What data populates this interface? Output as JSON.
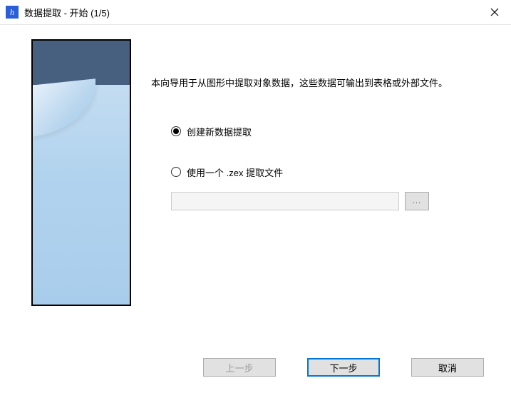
{
  "window": {
    "title": "数据提取 - 开始 (1/5)"
  },
  "intro": "本向导用于从图形中提取对象数据，这些数据可输出到表格或外部文件。",
  "options": {
    "create_new": "创建新数据提取",
    "use_file": "使用一个 .zex 提取文件",
    "file_value": "",
    "browse_label": "..."
  },
  "buttons": {
    "back": "上一步",
    "next": "下一步",
    "cancel": "取消"
  }
}
